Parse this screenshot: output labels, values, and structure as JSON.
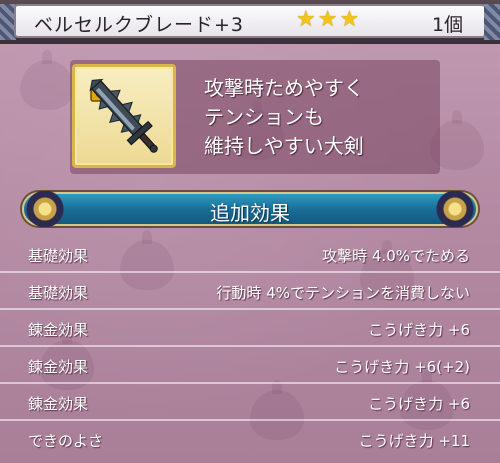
{
  "item": {
    "name": "ベルセルクブレード+3",
    "stars": [
      "★",
      "★",
      "★"
    ],
    "count": "1個",
    "icon": "lock-icon + greatsword-icon"
  },
  "description": {
    "lines": [
      "攻撃時ためやすく",
      "テンションも",
      "維持しやすい大剣"
    ]
  },
  "bonus": {
    "title": "追加効果"
  },
  "stats": [
    {
      "label": "基礎効果",
      "value": "攻撃時 4.0%でためる"
    },
    {
      "label": "基礎効果",
      "value": "行動時 4%でテンションを消費しない"
    },
    {
      "label": "錬金効果",
      "value": "こうげき力 +6"
    },
    {
      "label": "錬金効果",
      "value": "こうげき力 +6(+2)"
    },
    {
      "label": "錬金効果",
      "value": "こうげき力 +6"
    },
    {
      "label": "できのよさ",
      "value": "こうげき力 +11"
    }
  ],
  "colors": {
    "background": "#b98fa8",
    "star": "#f2c417",
    "bonus_bar": "#1a6e97",
    "icon_frame": "#ecd993"
  }
}
